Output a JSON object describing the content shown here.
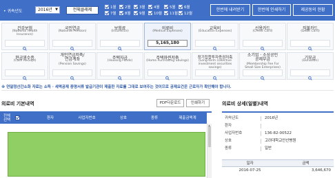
{
  "toolbar": {
    "year_label": "• 귀속년도",
    "year_value": "2016년",
    "select_all": "전체클래제",
    "months": [
      "1월",
      "2월",
      "3월",
      "4월",
      "5월",
      "6월",
      "7월",
      "8월",
      "9월",
      "10월",
      "11월",
      "12월"
    ],
    "download": "한번에 내려받기",
    "print": "한번에 인쇄하기",
    "status": "제공동의 현황"
  },
  "categories": [
    {
      "ko": "건강보험",
      "en": "(National Health\nInsurance)"
    },
    {
      "ko": "국민연금",
      "en": "(National Pension)"
    },
    {
      "ko": "보험료",
      "en": "(Insurance)"
    },
    {
      "ko": "의료비",
      "en": "(Medical Expenses)",
      "amount": "5,165,180"
    },
    {
      "ko": "교육비",
      "en": "(Education Expenses)"
    },
    {
      "ko": "신용카드",
      "en": "(Credit Card)"
    },
    {
      "ko": "직불카드",
      "en": "(Debit Card)"
    },
    {
      "ko": "현금영수증",
      "en": "(Cash Receipt)"
    },
    {
      "ko": "개인연금저축/\n연금계좌",
      "en": "(Pension Savings)"
    },
    {
      "ko": "주택자금",
      "en": "(Housing Funds)"
    },
    {
      "ko": "주택마련저축",
      "en": "(Home Purchasing Savings)"
    },
    {
      "ko": "장기집합투자증권저축",
      "en": "(Long-term collective\ninvestment securities\nsavings)"
    },
    {
      "ko": "소기업 · 소상공인\n공제부금",
      "en": "(Membership Fee For\nSmall Size Enterprises)"
    },
    {
      "ko": "기부금",
      "en": "(Donation)"
    }
  ],
  "notice": "※ 연말정산간소화 자료는 소득 · 세액공제 증명서류 발급기관이 제출한 자료를 그대로 보여주는 것이므로 공제요건은 근로자가 확인해야 합니다.",
  "left_panel": {
    "title": "의료비 기본내역",
    "pdf_button": "PDF다운로드",
    "print_button": "인쇄하기",
    "headers": [
      "전체\n선택",
      "",
      "환자",
      "사업자번호",
      "상호",
      "종류",
      "제출금액계"
    ]
  },
  "right_panel": {
    "title": "의료비 상세(일별)내역",
    "fields": [
      {
        "label": "귀속년도",
        "value": "2016년"
      },
      {
        "label": "환자",
        "value": ""
      },
      {
        "label": "사업자번호",
        "value": "136-82-00522"
      },
      {
        "label": "상호",
        "value": "고려대학교안산병원"
      },
      {
        "label": "종류",
        "value": "일반"
      }
    ],
    "table_headers": [
      "일자",
      "금액"
    ],
    "rows": [
      {
        "date": "2016-07-25",
        "amount": "3,646,670"
      }
    ]
  },
  "colors": {
    "primary": "#3f6fc6",
    "highlight": "#8fcf63"
  }
}
